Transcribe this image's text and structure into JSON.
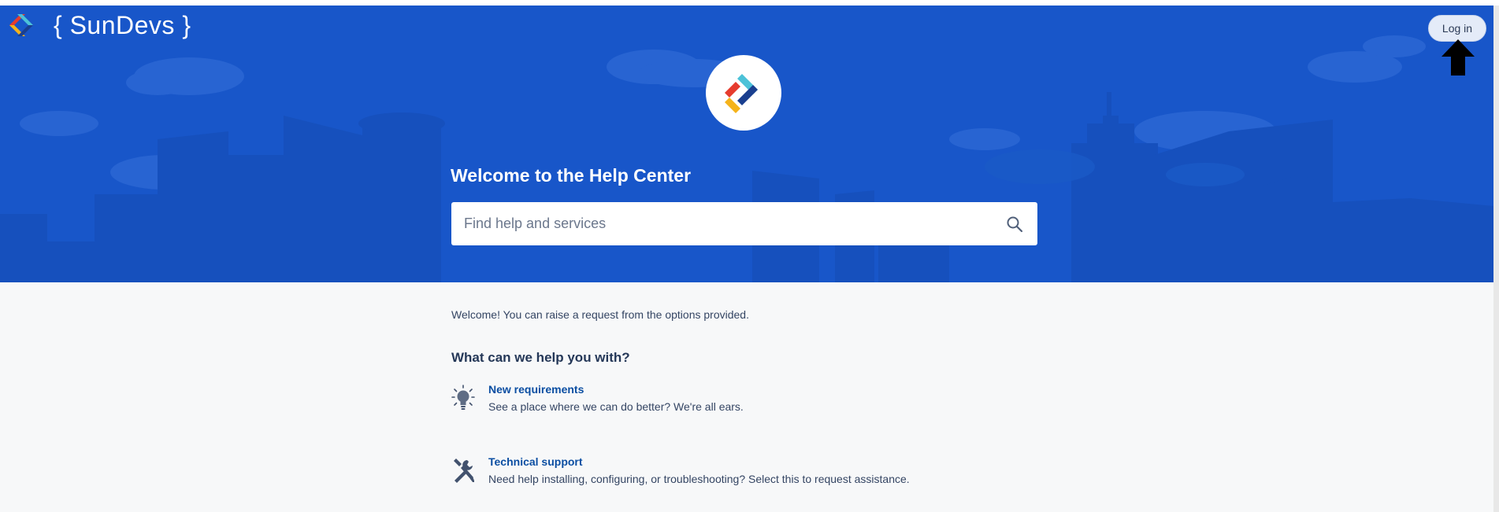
{
  "header": {
    "brand_name": "{ SunDevs }",
    "login_label": "Log in"
  },
  "hero": {
    "title": "Welcome to the Help Center",
    "search_placeholder": "Find help and services"
  },
  "main": {
    "intro": "Welcome! You can raise a request from the options provided.",
    "heading": "What can we help you with?",
    "request_types": [
      {
        "title": "New requirements",
        "description": "See a place where we can do better? We're all ears.",
        "icon": "lightbulb-icon"
      },
      {
        "title": "Technical support",
        "description": "Need help installing, configuring, or troubleshooting? Select this to request assistance.",
        "icon": "wrench-screwdriver-icon"
      }
    ]
  },
  "colors": {
    "hero_bg": "#1856c9",
    "page_bg": "#f7f8f9",
    "link": "#0b4ea2",
    "text": "#344563"
  }
}
